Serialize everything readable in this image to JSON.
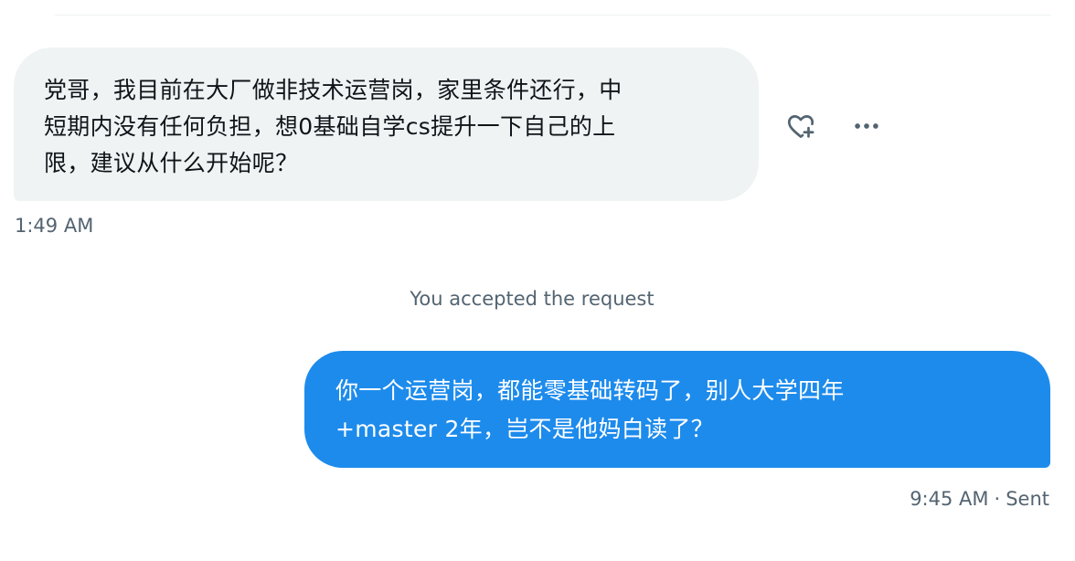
{
  "conversation": {
    "incoming": {
      "lines": [
        "党哥，我目前在大厂做非技术运营岗，家里条件还行，中",
        "短期内没有任何负担，想0基础自学cs提升一下自己的上",
        "限，建议从什么开始呢？"
      ],
      "time": "1:49 AM",
      "actions": {
        "react_icon": "heart-plus-icon",
        "more_icon": "more-horizontal-icon"
      }
    },
    "system_note": "You accepted the request",
    "outgoing": {
      "lines": [
        "你一个运营岗，都能零基础转码了，别人大学四年",
        "+master 2年，岂不是他妈白读了？"
      ],
      "time": "9:45 AM",
      "separator": "·",
      "status": "Sent"
    }
  },
  "colors": {
    "incoming_bubble": "#eff3f4",
    "outgoing_bubble": "#1d8bec",
    "primary_text": "#0f1419",
    "secondary_text": "#536471"
  }
}
